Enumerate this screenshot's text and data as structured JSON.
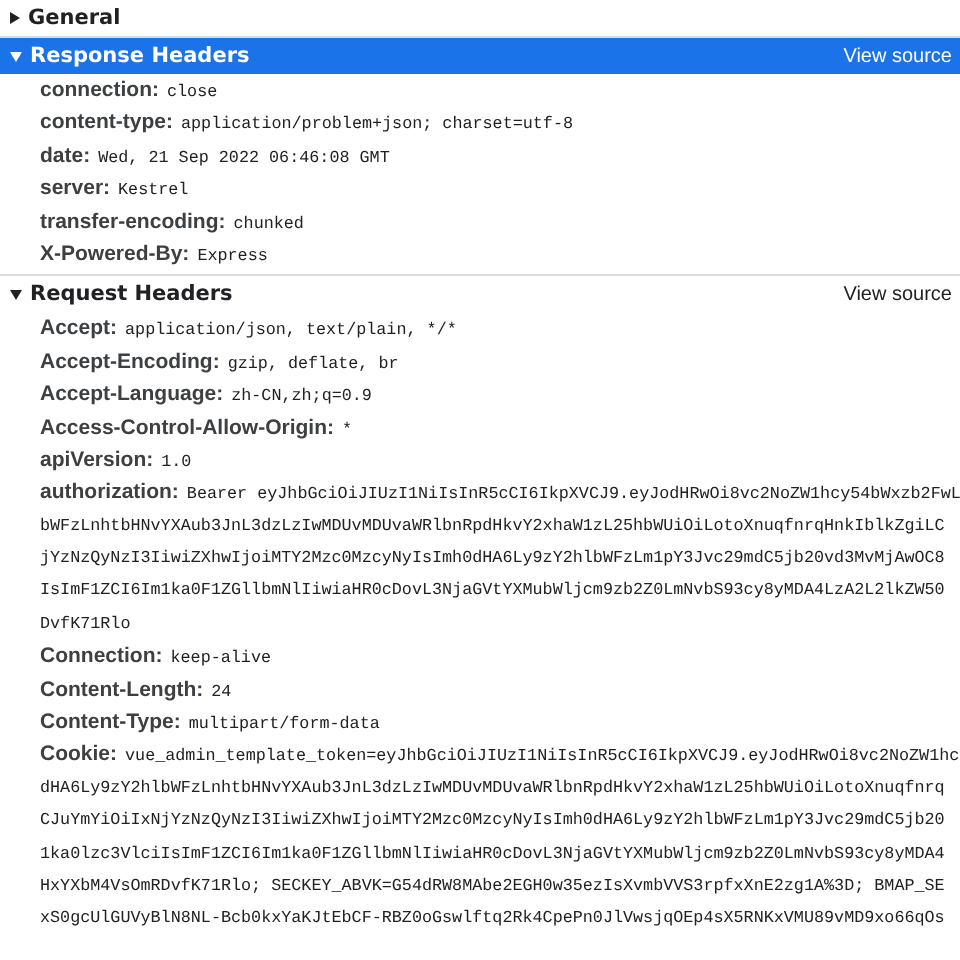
{
  "sections": [
    {
      "title": "General",
      "expanded": false,
      "selected": false
    },
    {
      "title": "Response Headers",
      "expanded": true,
      "selected": true,
      "view_source": "View source",
      "headers": [
        {
          "name": "connection:",
          "value_lines": [
            "close"
          ]
        },
        {
          "name": "content-type:",
          "value_lines": [
            "application/problem+json; charset=utf-8"
          ]
        },
        {
          "name": "date:",
          "value_lines": [
            "Wed, 21 Sep 2022 06:46:08 GMT"
          ]
        },
        {
          "name": "server:",
          "value_lines": [
            "Kestrel"
          ]
        },
        {
          "name": "transfer-encoding:",
          "value_lines": [
            "chunked"
          ]
        },
        {
          "name": "X-Powered-By:",
          "value_lines": [
            "Express"
          ]
        }
      ]
    },
    {
      "title": "Request Headers",
      "expanded": true,
      "selected": false,
      "view_source": "View source",
      "headers": [
        {
          "name": "Accept:",
          "value_lines": [
            "application/json, text/plain, */*"
          ]
        },
        {
          "name": "Accept-Encoding:",
          "value_lines": [
            "gzip, deflate, br"
          ]
        },
        {
          "name": "Accept-Language:",
          "value_lines": [
            "zh-CN,zh;q=0.9"
          ]
        },
        {
          "name": "Access-Control-Allow-Origin:",
          "value_lines": [
            "*"
          ]
        },
        {
          "name": "apiVersion:",
          "value_lines": [
            "1.0"
          ]
        },
        {
          "name": "authorization:",
          "value_lines": [
            "Bearer eyJhbGciOiJIUzI1NiIsInR5cCI6IkpXVCJ9.eyJodHRwOi8vc2NoZW1hcy54bWxzb2FwL",
            "bWFzLnhtbHNvYXAub3JnL3dzLzIwMDUvMDUvaWRlbnRpdHkvY2xhaW1zL25hbWUiOiLotoXnuqfnrqHnkIblkZgiLC",
            "jYzNzQyNzI3IiwiZXhwIjoiMTY2Mzc0MzcyNyIsImh0dHA6Ly9zY2hlbWFzLm1pY3Jvc29mdC5jb20vd3MvMjAwOC8",
            "IsImF1ZCI6Im1ka0F1ZGllbmNlIiwiaHR0cDovL3NjaGVtYXMubWljcm9zb2Z0LmNvbS93cy8yMDA4LzA2L2lkZW50",
            "DvfK71Rlo"
          ]
        },
        {
          "name": "Connection:",
          "value_lines": [
            "keep-alive"
          ]
        },
        {
          "name": "Content-Length:",
          "value_lines": [
            "24"
          ]
        },
        {
          "name": "Content-Type:",
          "value_lines": [
            "multipart/form-data"
          ]
        },
        {
          "name": "Cookie:",
          "value_lines": [
            "vue_admin_template_token=eyJhbGciOiJIUzI1NiIsInR5cCI6IkpXVCJ9.eyJodHRwOi8vc2NoZW1hc",
            "dHA6Ly9zY2hlbWFzLnhtbHNvYXAub3JnL3dzLzIwMDUvMDUvaWRlbnRpdHkvY2xhaW1zL25hbWUiOiLotoXnuqfnrq",
            "CJuYmYiOiIxNjYzNzQyNzI3IiwiZXhwIjoiMTY2Mzc0MzcyNyIsImh0dHA6Ly9zY2hlbWFzLm1pY3Jvc29mdC5jb20",
            "1ka0lzc3VlciIsImF1ZCI6Im1ka0F1ZGllbmNlIiwiaHR0cDovL3NjaGVtYXMubWljcm9zb2Z0LmNvbS93cy8yMDA4",
            "HxYXbM4VsOmRDvfK71Rlo; SECKEY_ABVK=G54dRW8MAbe2EGH0w35ezIsXvmbVVS3rpfxXnE2zg1A%3D; BMAP_SE",
            "xS0gcUlGUVyBlN8NL-Bcb0kxYaKJtEbCF-RBZ0oGswlftq2Rk4CpePn0JlVwsjqOEp4sX5RNKxVMU89vMD9xo66qOs"
          ]
        }
      ]
    }
  ]
}
